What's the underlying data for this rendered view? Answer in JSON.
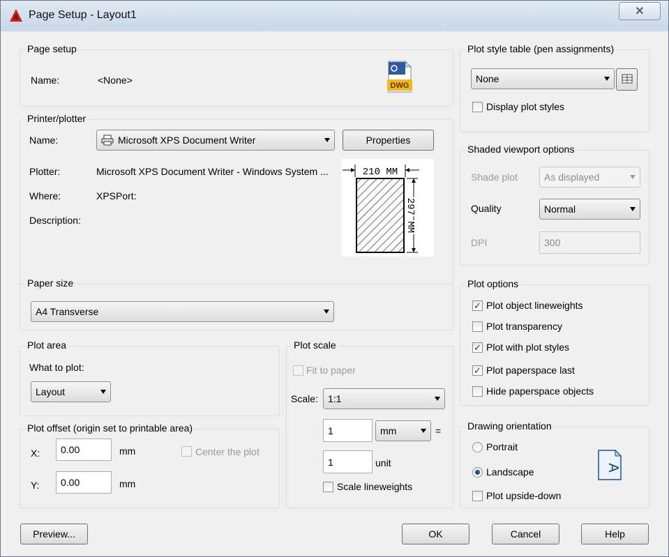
{
  "window": {
    "title": "Page Setup - Layout1",
    "close_glyph": "✕"
  },
  "page_setup": {
    "legend": "Page setup",
    "name_label": "Name:",
    "name_value": "<None>",
    "file_icon_text": "DWG"
  },
  "printer": {
    "legend": "Printer/plotter",
    "name_label": "Name:",
    "name_value": "Microsoft XPS Document Writer",
    "properties_label": "Properties",
    "plotter_label": "Plotter:",
    "plotter_value": "Microsoft XPS Document Writer - Windows System ...",
    "where_label": "Where:",
    "where_value": "XPSPort:",
    "description_label": "Description:",
    "preview_width_text": "210 MM",
    "preview_height_text": "297 MM"
  },
  "paper_size": {
    "legend": "Paper size",
    "value": "A4 Transverse"
  },
  "plot_area": {
    "legend": "Plot area",
    "what_label": "What to plot:",
    "what_value": "Layout"
  },
  "plot_offset": {
    "legend": "Plot offset (origin set to printable area)",
    "x_label": "X:",
    "x_value": "0.00",
    "x_unit": "mm",
    "y_label": "Y:",
    "y_value": "0.00",
    "y_unit": "mm",
    "center_label": "Center the plot"
  },
  "plot_scale": {
    "legend": "Plot scale",
    "fit_label": "Fit to paper",
    "scale_label": "Scale:",
    "scale_value": "1:1",
    "value1": "1",
    "unit1": "mm",
    "equals": "=",
    "value2": "1",
    "unit2": "unit",
    "lineweights_label": "Scale lineweights"
  },
  "plot_style_table": {
    "legend": "Plot style table (pen assignments)",
    "value": "None",
    "display_label": "Display plot styles"
  },
  "shaded_viewport": {
    "legend": "Shaded viewport options",
    "shade_label": "Shade plot",
    "shade_value": "As displayed",
    "quality_label": "Quality",
    "quality_value": "Normal",
    "dpi_label": "DPI",
    "dpi_value": "300"
  },
  "plot_options": {
    "legend": "Plot options",
    "items": [
      {
        "label": "Plot object lineweights",
        "checked": true
      },
      {
        "label": "Plot transparency",
        "checked": false
      },
      {
        "label": "Plot with plot styles",
        "checked": true
      },
      {
        "label": "Plot paperspace last",
        "checked": true
      },
      {
        "label": "Hide paperspace objects",
        "checked": false
      }
    ],
    "check_glyph": "✓"
  },
  "orientation": {
    "legend": "Drawing orientation",
    "portrait_label": "Portrait",
    "landscape_label": "Landscape",
    "upside_down_label": "Plot upside-down",
    "icon_text": "A"
  },
  "buttons": {
    "preview": "Preview...",
    "ok": "OK",
    "cancel": "Cancel",
    "help": "Help"
  },
  "colors": {
    "title_icon": "#cc1f1f",
    "dwg_yellow": "#f2b71f",
    "dwg_blue": "#2f5b9c"
  }
}
